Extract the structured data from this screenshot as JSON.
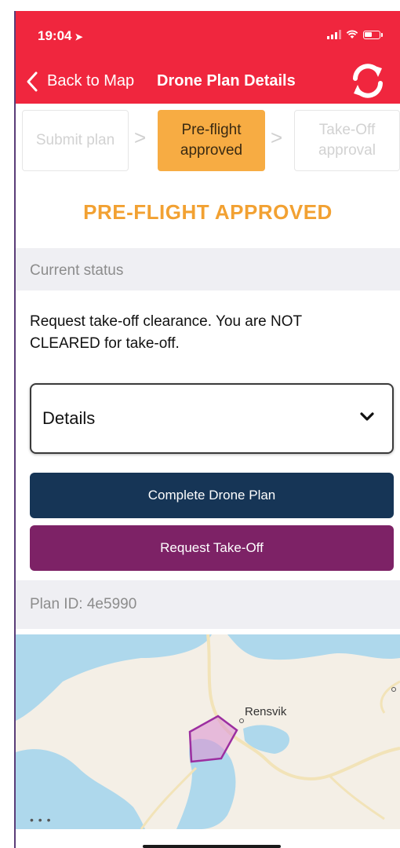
{
  "status_bar": {
    "time": "19:04",
    "location_icon": "location-arrow-icon"
  },
  "nav": {
    "back_label": "Back to Map",
    "title": "Drone Plan Details",
    "refresh_icon": "refresh-icon"
  },
  "steps": [
    {
      "label": "Submit plan",
      "state": "inactive"
    },
    {
      "label": "Pre-flight approved",
      "state": "active"
    },
    {
      "label": "Take-Off approval",
      "state": "inactive"
    }
  ],
  "step_separator": ">",
  "approval_status": "PRE-FLIGHT APPROVED",
  "current_status": {
    "label": "Current status",
    "message": "Request take-off clearance. You are NOT CLEARED for take-off."
  },
  "details": {
    "label": "Details"
  },
  "buttons": {
    "complete": "Complete Drone Plan",
    "request": "Request Take-Off"
  },
  "plan": {
    "id_text": "Plan ID: 4e5990"
  },
  "map": {
    "place_label": "Rensvik",
    "attribution_dots": "• • •"
  },
  "colors": {
    "header": "#f0263e",
    "active_step": "#f7ac43",
    "approved_text": "#f2a132",
    "complete_button": "#163556",
    "request_button": "#7d2266"
  }
}
